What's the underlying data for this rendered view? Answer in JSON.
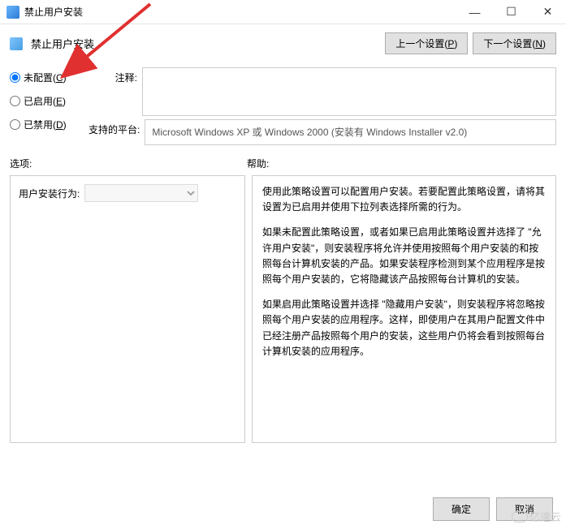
{
  "window": {
    "title": "禁止用户安装"
  },
  "header": {
    "title": "禁止用户安装",
    "prev_button": "上一个设置(P)",
    "prev_key": "P",
    "next_button": "下一个设置(N)",
    "next_key": "N"
  },
  "radios": {
    "not_configured": "未配置(C)",
    "not_configured_key": "C",
    "enabled": "已启用(E)",
    "enabled_key": "E",
    "disabled": "已禁用(D)",
    "disabled_key": "D",
    "selected": "not_configured"
  },
  "fields": {
    "comment_label": "注释:",
    "comment_value": "",
    "platform_label": "支持的平台:",
    "platform_value": "Microsoft Windows XP 或 Windows 2000 (安装有 Windows Installer v2.0)"
  },
  "sections": {
    "options_label": "选项:",
    "help_label": "帮助:"
  },
  "options": {
    "behavior_label": "用户安装行为:",
    "behavior_value": ""
  },
  "help": {
    "p1": "使用此策略设置可以配置用户安装。若要配置此策略设置，请将其设置为已启用并使用下拉列表选择所需的行为。",
    "p2": "如果未配置此策略设置，或者如果已启用此策略设置并选择了 \"允许用户安装\"，则安装程序将允许并使用按照每个用户安装的和按照每台计算机安装的产品。如果安装程序检测到某个应用程序是按照每个用户安装的，它将隐藏该产品按照每台计算机的安装。",
    "p3": "如果启用此策略设置并选择 \"隐藏用户安装\"，则安装程序将忽略按照每个用户安装的应用程序。这样，即使用户在其用户配置文件中已经注册产品按照每个用户的安装，这些用户仍将会看到按照每台计算机安装的应用程序。"
  },
  "footer": {
    "ok": "确定",
    "cancel": "取消"
  },
  "watermark": {
    "text": "亿速云"
  }
}
